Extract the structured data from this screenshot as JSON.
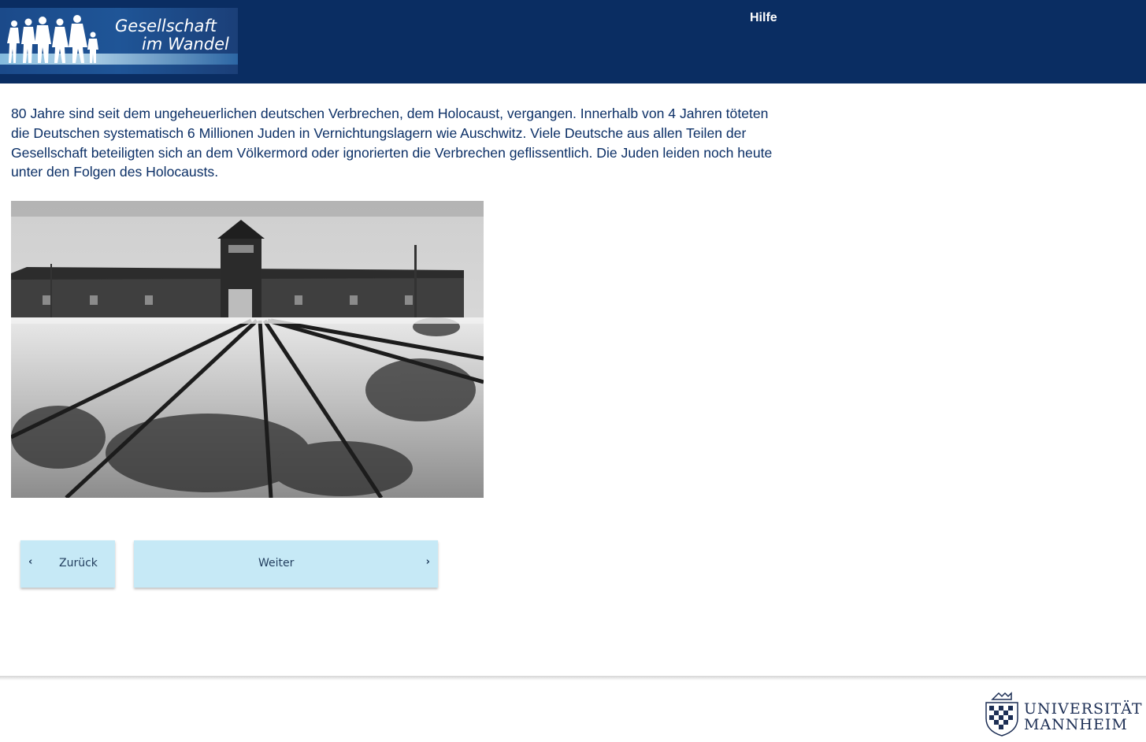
{
  "header": {
    "logo": {
      "line1": "Gesellschaft",
      "line2": "im Wandel"
    },
    "help_label": "Hilfe"
  },
  "content": {
    "intro_text": "80 Jahre sind seit dem ungeheuerlichen deutschen Verbrechen, dem Holocaust, vergangen. Innerhalb von 4 Jahren töteten die Deutschen systematisch 6 Millionen Juden in Vernichtungslagern wie Auschwitz. Viele Deutsche aus allen Teilen der Gesellschaft beteiligten sich an dem Völkermord oder ignorierten die Verbrechen geflissentlich. Die Juden leiden noch heute unter den Folgen des Holocausts."
  },
  "navigation": {
    "back_label": "Zurück",
    "back_icon": "chevron-left-icon",
    "next_label": "Weiter",
    "next_icon": "chevron-right-icon"
  },
  "footer": {
    "university_line1": "UNIVERSITÄT",
    "university_line2": "MANNHEIM"
  },
  "colors": {
    "header_bg": "#0a2d62",
    "text": "#0b2f66",
    "button_bg": "#c6e9f6"
  }
}
